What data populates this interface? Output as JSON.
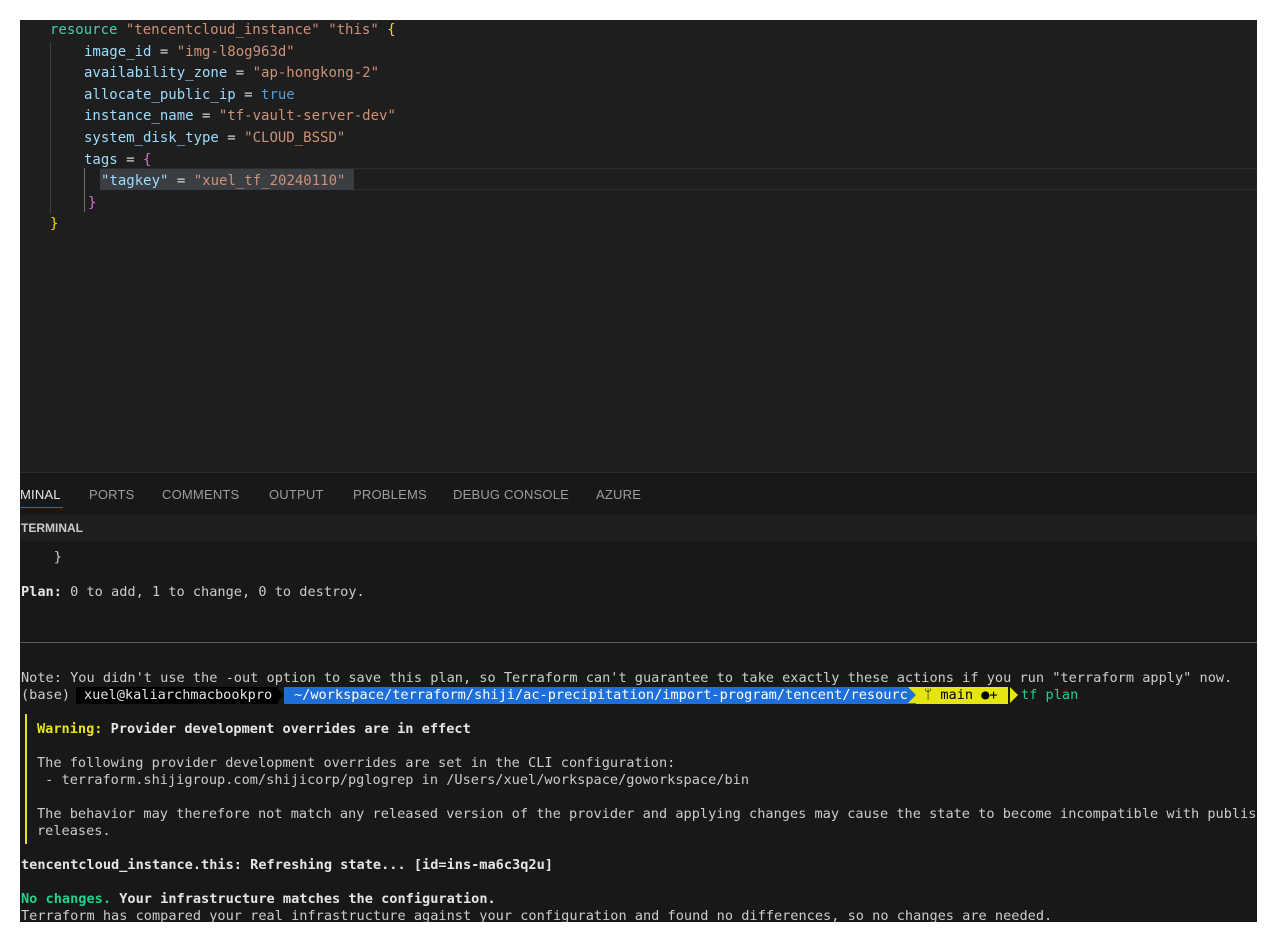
{
  "editor": {
    "lines": [
      {
        "kw": "resource",
        "s1": "\"tencentcloud_instance\"",
        "s2": "\"this\"",
        "brace": "{"
      },
      {
        "attr": "image_id",
        "eq": " = ",
        "val": "\"img-l8og963d\""
      },
      {
        "attr": "availability_zone",
        "eq": " = ",
        "val": "\"ap-hongkong-2\""
      },
      {
        "attr": "allocate_public_ip",
        "eq": " = ",
        "val": "true"
      },
      {
        "attr": "instance_name",
        "eq": " = ",
        "val": "\"tf-vault-server-dev\""
      },
      {
        "attr": "system_disk_type",
        "eq": " = ",
        "val": "\"CLOUD_BSSD\""
      },
      {
        "attr": "tags",
        "eq": " = ",
        "val": "{"
      },
      {
        "attr": "\"tagkey\"",
        "eq": " = ",
        "val": "\"xuel_tf_20240110\""
      },
      {
        "val": "}"
      },
      {
        "val": "}"
      }
    ]
  },
  "panel": {
    "tabs": [
      "MINAL",
      "PORTS",
      "COMMENTS",
      "OUTPUT",
      "PROBLEMS",
      "DEBUG CONSOLE",
      "AZURE"
    ],
    "section": "TERMINAL"
  },
  "terminal": {
    "l_brace": "    }",
    "plan_label": "Plan:",
    "plan_rest": " 0 to add, 1 to change, 0 to destroy.",
    "note": "Note: You didn't use the -out option to save this plan, so Terraform can't guarantee to take exactly these actions if you run \"terraform apply\" now.",
    "prompt": {
      "base": "(base)",
      "user": "xuel@kaliarchmacbookpro",
      "path": "~/workspace/terraform/shiji/ac-precipitation/import-program/tencent/resource",
      "git": "ᛘ main ●+",
      "cmd": "tf plan"
    },
    "warning_label": "Warning:",
    "warning_title": " Provider development overrides are in effect",
    "overrides_intro": "The following provider development overrides are set in the CLI configuration:",
    "override_item": " - terraform.shijigroup.com/shijicorp/pglogrep in /Users/xuel/workspace/goworkspace/bin",
    "behavior_1": "The behavior may therefore not match any released version of the provider and applying changes may cause the state to become incompatible with published",
    "behavior_2": "releases.",
    "refreshing": "tencentcloud_instance.this: Refreshing state... [id=ins-ma6c3q2u]",
    "no_changes_label": "No changes.",
    "no_changes_rest": " Your infrastructure matches the configuration.",
    "compared": "Terraform has compared your real infrastructure against your configuration and found no differences, so no changes are needed."
  },
  "colors": {
    "path_bg": "#1e6fd9",
    "git_bg": "#e5e510",
    "warning": "#e5e510",
    "success": "#23d18b"
  }
}
